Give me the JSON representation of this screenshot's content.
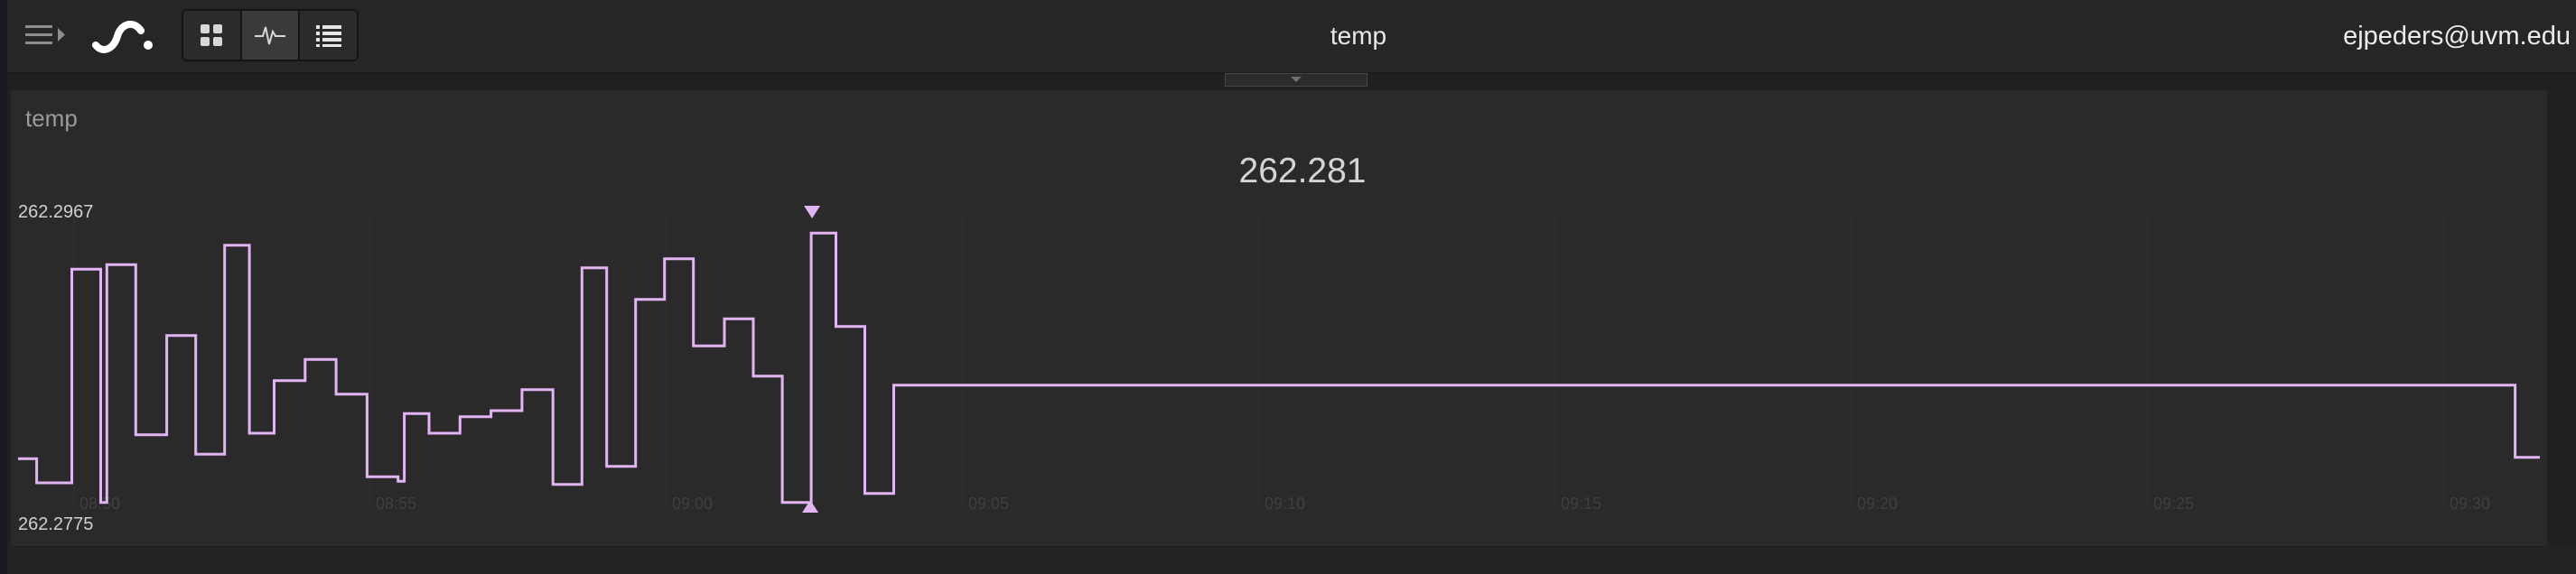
{
  "topbar": {
    "title": "temp",
    "user_email": "ejpeders@uvm.edu",
    "view_modes": [
      {
        "name": "grid",
        "icon": "grid-icon",
        "active": false
      },
      {
        "name": "waveform",
        "icon": "waveform-icon",
        "active": true
      },
      {
        "name": "list",
        "icon": "list-icon",
        "active": false
      }
    ]
  },
  "panel": {
    "title": "temp",
    "current_value": "262.281"
  },
  "chart_data": {
    "type": "line",
    "step": true,
    "color": "#e3b4f4",
    "ylim": [
      262.2775,
      262.2967
    ],
    "y_max_label": "262.2967",
    "y_min_label": "262.2775",
    "max_marker_index": 29,
    "min_marker_index": 28,
    "x": [
      0,
      1,
      2,
      3,
      4,
      5,
      6,
      7,
      8,
      9,
      10,
      11,
      12,
      13,
      14,
      15,
      16,
      17,
      18,
      19,
      20,
      21,
      22,
      23,
      24,
      25,
      26,
      27,
      28,
      29,
      30,
      31,
      32
    ],
    "y": [
      262.2806,
      262.279,
      262.2932,
      262.2777,
      262.2935,
      262.2822,
      262.2888,
      262.2809,
      262.2948,
      262.2823,
      262.2858,
      262.2872,
      262.2849,
      262.2794,
      262.2791,
      262.2836,
      262.2823,
      262.2834,
      262.2838,
      262.2852,
      262.2789,
      262.2933,
      262.2801,
      262.2912,
      262.2939,
      262.2881,
      262.2899,
      262.2861,
      262.2777,
      262.2956,
      262.2894,
      262.2783,
      262.2855,
      262.2807
    ],
    "x_tick_labels": [
      "08:50",
      "08:55",
      "09:00",
      "09:05",
      "09:10",
      "09:15",
      "09:20",
      "09:25",
      "09:30"
    ]
  }
}
